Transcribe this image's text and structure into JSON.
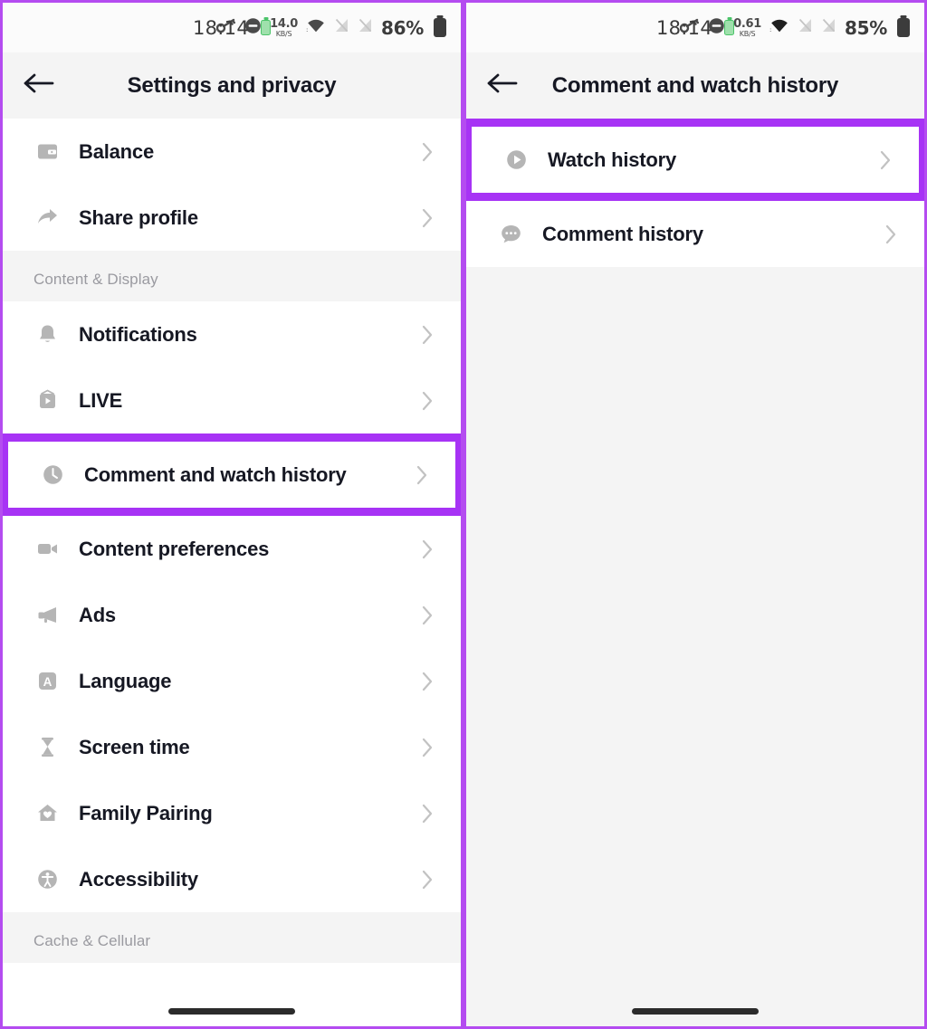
{
  "theme": {
    "highlight_purple": "#a733f5",
    "frame_purple": "#b44cf0",
    "page_bg": "#f4f4f4",
    "card_bg": "#ffffff",
    "text_primary": "#161823",
    "text_muted": "#9a9aa0",
    "icon_gray": "#b5b5b5"
  },
  "left_panel": {
    "status_bar": {
      "time": "18:14",
      "battery_small_icon": "battery-charging-icon",
      "key_icon": "key-icon",
      "dnd_icon": "do-not-disturb-icon",
      "net_speed_value": "14.0",
      "net_speed_unit": "KB/S",
      "wifi_icon": "wifi-icon",
      "sim1_icon": "sim-no-signal-icon",
      "sim2_icon": "sim-no-signal-icon",
      "battery_percent": "86%",
      "battery_icon": "battery-icon"
    },
    "app_bar": {
      "back_icon": "back-arrow-icon",
      "title": "Settings and privacy"
    },
    "groups": [
      {
        "label": null,
        "items": [
          {
            "label": "Balance",
            "icon": "wallet-icon",
            "highlighted": false
          },
          {
            "label": "Share profile",
            "icon": "share-arrow-icon",
            "highlighted": false
          }
        ]
      },
      {
        "label": "Content & Display",
        "items": [
          {
            "label": "Notifications",
            "icon": "bell-icon",
            "highlighted": false
          },
          {
            "label": "LIVE",
            "icon": "live-tv-icon",
            "highlighted": false
          },
          {
            "label": "Comment and watch history",
            "icon": "clock-icon",
            "highlighted": true
          },
          {
            "label": "Content preferences",
            "icon": "video-camera-icon",
            "highlighted": false
          },
          {
            "label": "Ads",
            "icon": "megaphone-icon",
            "highlighted": false
          },
          {
            "label": "Language",
            "icon": "language-a-icon",
            "highlighted": false
          },
          {
            "label": "Screen time",
            "icon": "hourglass-icon",
            "highlighted": false
          },
          {
            "label": "Family Pairing",
            "icon": "house-heart-icon",
            "highlighted": false
          },
          {
            "label": "Accessibility",
            "icon": "accessibility-icon",
            "highlighted": false
          }
        ]
      },
      {
        "label": "Cache & Cellular",
        "items": []
      }
    ]
  },
  "right_panel": {
    "status_bar": {
      "time": "18:14",
      "battery_small_icon": "battery-charging-icon",
      "key_icon": "key-icon",
      "dnd_icon": "do-not-disturb-icon",
      "net_speed_value": "0.61",
      "net_speed_unit": "KB/S",
      "wifi_icon": "wifi-icon",
      "sim1_icon": "sim-no-signal-icon",
      "sim2_icon": "sim-no-signal-icon",
      "battery_percent": "85%",
      "battery_icon": "battery-icon"
    },
    "app_bar": {
      "back_icon": "back-arrow-icon",
      "title": "Comment and watch history"
    },
    "items": [
      {
        "label": "Watch history",
        "icon": "play-circle-icon",
        "highlighted": true
      },
      {
        "label": "Comment history",
        "icon": "comment-bubble-icon",
        "highlighted": false
      }
    ]
  }
}
